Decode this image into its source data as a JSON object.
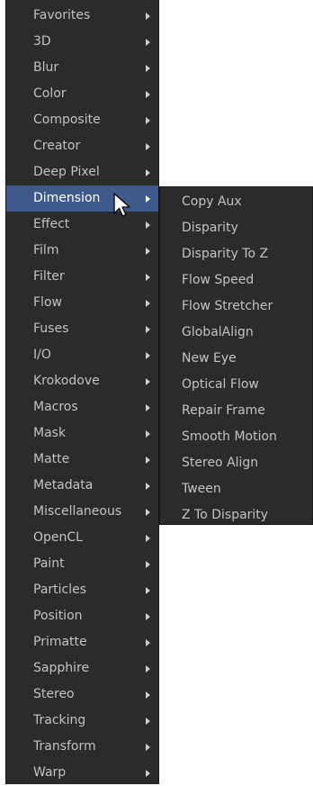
{
  "menu": {
    "items": [
      {
        "label": "Favorites"
      },
      {
        "label": "3D"
      },
      {
        "label": "Blur"
      },
      {
        "label": "Color"
      },
      {
        "label": "Composite"
      },
      {
        "label": "Creator"
      },
      {
        "label": "Deep Pixel"
      },
      {
        "label": "Dimension"
      },
      {
        "label": "Effect"
      },
      {
        "label": "Film"
      },
      {
        "label": "Filter"
      },
      {
        "label": "Flow"
      },
      {
        "label": "Fuses"
      },
      {
        "label": "I/O"
      },
      {
        "label": "Krokodove"
      },
      {
        "label": "Macros"
      },
      {
        "label": "Mask"
      },
      {
        "label": "Matte"
      },
      {
        "label": "Metadata"
      },
      {
        "label": "Miscellaneous"
      },
      {
        "label": "OpenCL"
      },
      {
        "label": "Paint"
      },
      {
        "label": "Particles"
      },
      {
        "label": "Position"
      },
      {
        "label": "Primatte"
      },
      {
        "label": "Sapphire"
      },
      {
        "label": "Stereo"
      },
      {
        "label": "Tracking"
      },
      {
        "label": "Transform"
      },
      {
        "label": "Warp"
      }
    ],
    "highlighted_index": 7
  },
  "submenu": {
    "items": [
      {
        "label": "Copy Aux"
      },
      {
        "label": "Disparity"
      },
      {
        "label": "Disparity To Z"
      },
      {
        "label": "Flow Speed"
      },
      {
        "label": "Flow Stretcher"
      },
      {
        "label": "GlobalAlign"
      },
      {
        "label": "New Eye"
      },
      {
        "label": "Optical Flow"
      },
      {
        "label": "Repair Frame"
      },
      {
        "label": "Smooth Motion"
      },
      {
        "label": "Stereo Align"
      },
      {
        "label": "Tween"
      },
      {
        "label": "Z To Disparity"
      }
    ]
  },
  "colors": {
    "menu_background": "#2b2b2b",
    "highlight": "#3e5a8c",
    "text": "#c3c3c3"
  },
  "icons": {
    "submenu_arrow": "chevron-right-icon",
    "pointer": "mouse-cursor-icon"
  }
}
